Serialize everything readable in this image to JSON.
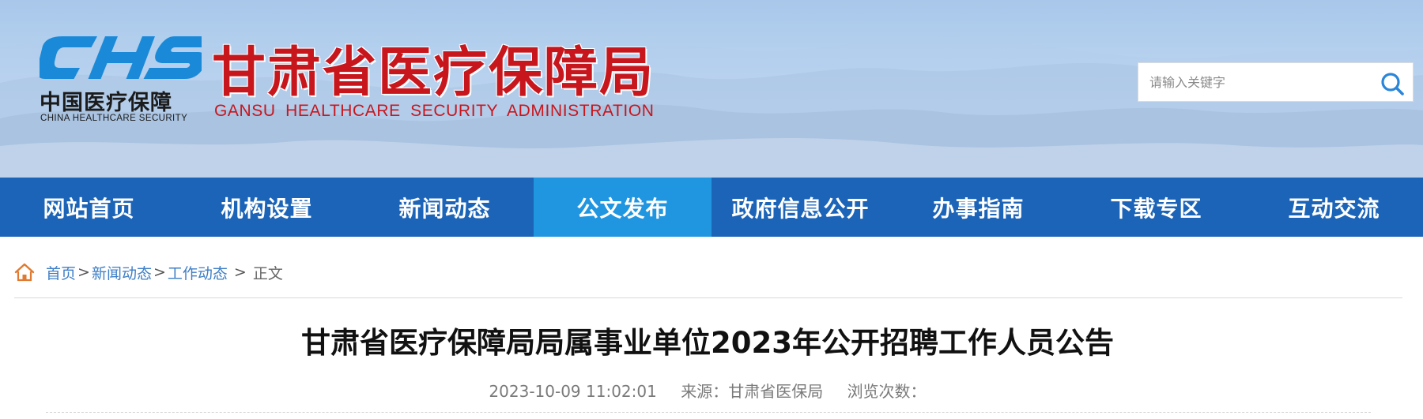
{
  "header": {
    "logo_text_cn": "中国医疗保障",
    "logo_text_en": "CHINA HEALTHCARE SECURITY",
    "logo_mark": "CHS",
    "site_title": "甘肃省医疗保障局",
    "site_subtitle": "GANSU HEALTHCARE SECURITY ADMINISTRATION",
    "search": {
      "placeholder": "请输入关键字",
      "value": "",
      "icon": "search-icon"
    },
    "colors": {
      "title_red": "#c8161d",
      "logo_blue": "#1a8ad8"
    }
  },
  "nav": {
    "items": [
      {
        "label": "网站首页"
      },
      {
        "label": "机构设置"
      },
      {
        "label": "新闻动态"
      },
      {
        "label": "公文发布",
        "active": true
      },
      {
        "label": "政府信息公开"
      },
      {
        "label": "办事指南"
      },
      {
        "label": "下载专区"
      },
      {
        "label": "互动交流"
      }
    ],
    "colors": {
      "background": "#1c64b7",
      "active": "#2196e0"
    }
  },
  "breadcrumb": {
    "icon": "home-icon",
    "items": [
      "首页",
      "新闻动态",
      "工作动态"
    ],
    "separator": ">",
    "current": "正文"
  },
  "article": {
    "title": "甘肃省医疗保障局局属事业单位2023年公开招聘工作人员公告",
    "date": "2023-10-09 11:02:01",
    "source": "来源：甘肃省医保局",
    "views": "浏览次数："
  }
}
